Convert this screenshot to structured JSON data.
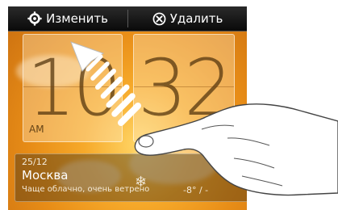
{
  "topbar": {
    "edit_label": "Изменить",
    "delete_label": "Удалить",
    "edit_icon": "gear-icon",
    "delete_icon": "close-circle-icon"
  },
  "clock": {
    "hours": "10",
    "minutes": "32",
    "ampm": "AM"
  },
  "weather": {
    "date": "25/12",
    "city": "Москва",
    "condition": "Чаще облачно, очень ветрено",
    "temp": "-8° / -",
    "icon": "snowflake-icon"
  },
  "gesture": {
    "hand_icon": "hand-pointer-icon",
    "arrow_icon": "drag-arrow-icon"
  },
  "colors": {
    "topbar": "#111111",
    "sunset_light": "#ffd667",
    "sunset_dark": "#c86d10"
  }
}
